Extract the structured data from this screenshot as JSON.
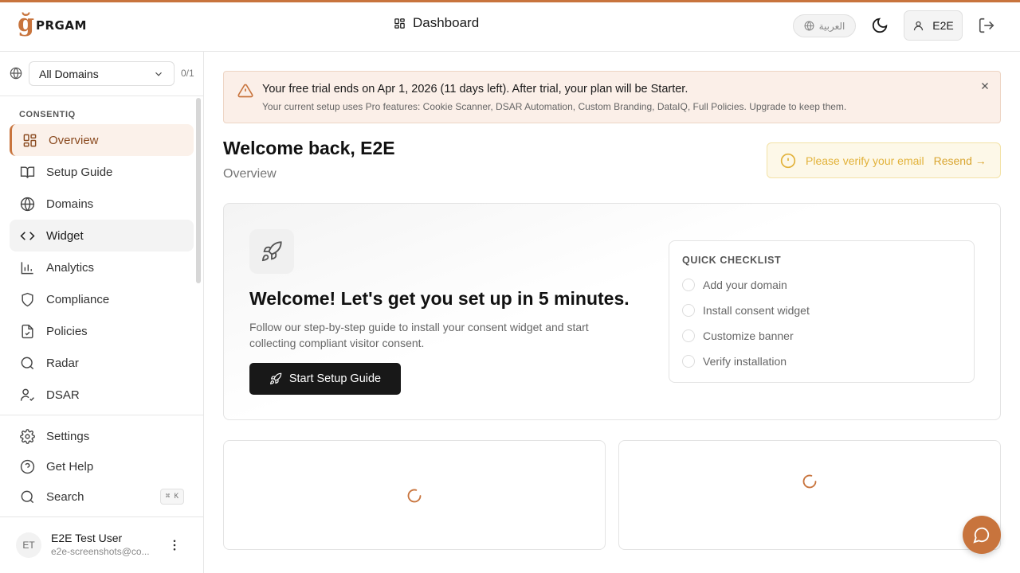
{
  "brand": {
    "logo_mark": "ğ",
    "logo_word": "PRGAM",
    "accent": "#c8743d"
  },
  "header": {
    "title": "Dashboard",
    "title_icon": "dashboard-grid-icon",
    "language": "العربية",
    "theme_icon": "moon-icon",
    "user_label": "E2E",
    "logout_icon": "logout-icon"
  },
  "sidebar": {
    "domain_select": "All Domains",
    "domain_count": "0/1",
    "section": "CONSENTIQ",
    "items": [
      {
        "label": "Overview",
        "icon": "dashboard-grid-icon",
        "active": true
      },
      {
        "label": "Setup Guide",
        "icon": "book-icon"
      },
      {
        "label": "Domains",
        "icon": "globe-icon"
      },
      {
        "label": "Widget",
        "icon": "code-icon"
      },
      {
        "label": "Analytics",
        "icon": "bar-chart-icon"
      },
      {
        "label": "Compliance",
        "icon": "shield-icon"
      },
      {
        "label": "Policies",
        "icon": "file-check-icon"
      },
      {
        "label": "Radar",
        "icon": "search-icon"
      },
      {
        "label": "DSAR",
        "icon": "user-check-icon"
      }
    ],
    "bottom_items": [
      {
        "label": "Settings",
        "icon": "gear-icon"
      },
      {
        "label": "Get Help",
        "icon": "help-circle-icon"
      },
      {
        "label": "Search",
        "icon": "search-icon",
        "shortcut": "⌘ K"
      }
    ],
    "user": {
      "initials": "ET",
      "name": "E2E Test User",
      "email": "e2e-screenshots@co..."
    }
  },
  "trial_banner": {
    "title": "Your free trial ends on Apr 1, 2026 (11 days left). After trial, your plan will be Starter.",
    "subtitle": "Your current setup uses Pro features: Cookie Scanner, DSAR Automation, Custom Branding, DataIQ, Full Policies. Upgrade to keep them."
  },
  "welcome": {
    "title": "Welcome back, E2E",
    "subtitle": "Overview"
  },
  "verify": {
    "text": "Please verify your email",
    "action": "Resend →"
  },
  "setup": {
    "title": "Welcome! Let's get you set up in 5 minutes.",
    "description": "Follow our step-by-step guide to install your consent widget and start collecting compliant visitor consent.",
    "button": "Start Setup Guide"
  },
  "checklist": {
    "title": "QUICK CHECKLIST",
    "items": [
      "Add your domain",
      "Install consent widget",
      "Customize banner",
      "Verify installation"
    ]
  }
}
